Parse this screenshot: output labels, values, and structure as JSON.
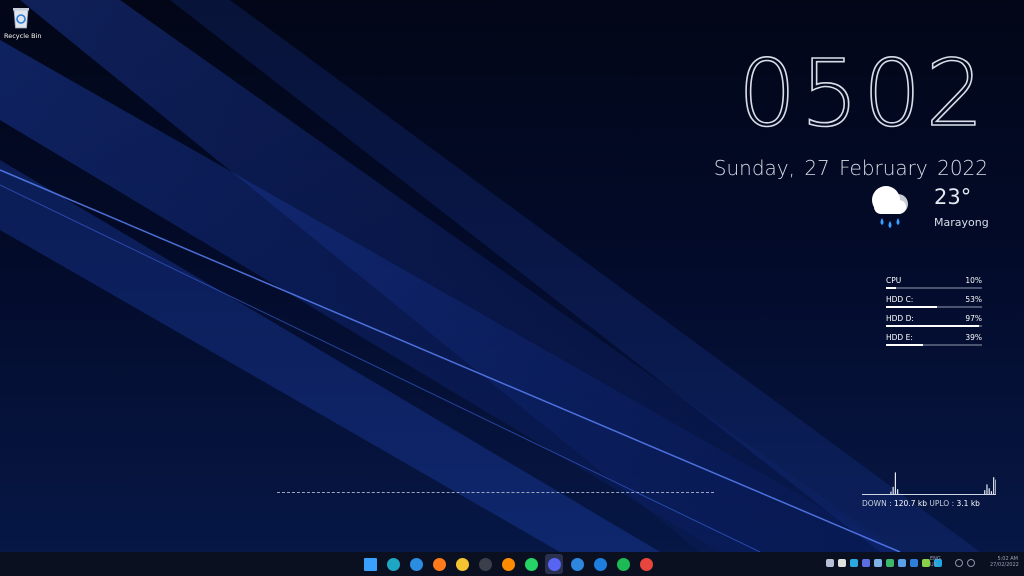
{
  "desktop": {
    "icons": [
      {
        "label": "Recycle Bin",
        "icon": "recycle-bin-icon"
      }
    ]
  },
  "clock": {
    "time": "0502",
    "date": "Sunday, 27  February  2022"
  },
  "weather": {
    "icon": "rain-cloud-icon",
    "temperature": "23°",
    "location": "Marayong"
  },
  "system_meters": [
    {
      "label": "CPU",
      "value_text": "10%",
      "fraction": 0.1
    },
    {
      "label": "HDD C:",
      "value_text": "53%",
      "fraction": 0.53
    },
    {
      "label": "HDD D:",
      "value_text": "97%",
      "fraction": 0.97
    },
    {
      "label": "HDD E:",
      "value_text": "39%",
      "fraction": 0.39
    }
  ],
  "network": {
    "down_label": "DOWN :",
    "down_value": "120.7 kb",
    "up_label": "UPLO :",
    "up_value": "3.1 kb",
    "graph_peaks": [
      0,
      0,
      0,
      0,
      0.05,
      0.15,
      0.45,
      0.1,
      0,
      0,
      0,
      0,
      0,
      0,
      0,
      0,
      0,
      0,
      0,
      0,
      0,
      0,
      0,
      0,
      0,
      0,
      0,
      0,
      0,
      0,
      0,
      0,
      0,
      0,
      0,
      0,
      0,
      0,
      0,
      0,
      0,
      0,
      0,
      0,
      0,
      0,
      0.08,
      0.2,
      0.12,
      0.06,
      0.35,
      0.3,
      0.1,
      0.95,
      0.25,
      0.05,
      0,
      0,
      0,
      0
    ]
  },
  "taskbar": {
    "apps": [
      {
        "name": "start-button",
        "icon": "windows-start-icon",
        "color": "#3aa0ff"
      },
      {
        "name": "edge-button",
        "icon": "edge-icon",
        "color": "#1fa6c4"
      },
      {
        "name": "edge-dev-button",
        "icon": "edge-dev-icon",
        "color": "#2b8de0"
      },
      {
        "name": "firefox-button",
        "icon": "firefox-icon",
        "color": "#ff7a1a"
      },
      {
        "name": "file-explorer-button",
        "icon": "folder-icon",
        "color": "#f4c430"
      },
      {
        "name": "terminal-button",
        "icon": "terminal-icon",
        "color": "#3a3f4b"
      },
      {
        "name": "vlc-button",
        "icon": "vlc-icon",
        "color": "#ff8c00"
      },
      {
        "name": "whatsapp-button",
        "icon": "whatsapp-icon",
        "color": "#25d366"
      },
      {
        "name": "discord-button",
        "icon": "discord-icon",
        "color": "#5865f2",
        "active": true
      },
      {
        "name": "store-button",
        "icon": "store-icon",
        "color": "#2e86de"
      },
      {
        "name": "app-button",
        "icon": "blue-app-icon",
        "color": "#1e7fe0"
      },
      {
        "name": "spotify-button",
        "icon": "spotify-icon",
        "color": "#1db954"
      },
      {
        "name": "photos-button",
        "icon": "photos-icon",
        "color": "#e8453c"
      }
    ],
    "tray_colors": [
      "#b7c0d6",
      "#e0e0e0",
      "#2aa7e0",
      "#5b6ee1",
      "#7fb3e6",
      "#3db86b",
      "#5aa0e6",
      "#2d7fd8",
      "#8ad14a",
      "#1ea7e0"
    ],
    "tray_text": [
      "ENG",
      "US"
    ],
    "time_text": [
      "5:02 AM",
      "27/02/2022"
    ]
  }
}
